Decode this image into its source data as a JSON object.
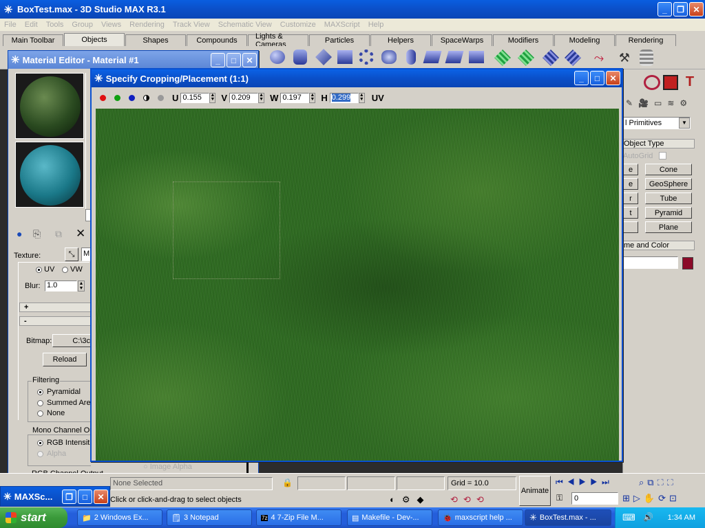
{
  "app": {
    "title": "BoxTest.max - 3D Studio MAX R3.1",
    "menu": [
      "File",
      "Edit",
      "Tools",
      "Group",
      "Views",
      "Rendering",
      "Track View",
      "Schematic View",
      "Customize",
      "MAXScript",
      "Help"
    ],
    "tabs": [
      "Main Toolbar",
      "Objects",
      "Shapes",
      "Compounds",
      "Lights & Cameras",
      "Particles",
      "Helpers",
      "SpaceWarps",
      "Modifiers",
      "Modeling",
      "Rendering"
    ],
    "active_tab": "Objects"
  },
  "material_editor": {
    "title": "Material Editor - Material #1",
    "texture_label": "Texture:",
    "uv_label": "UV",
    "vw_label": "VW",
    "blur_label": "Blur:",
    "blur_value": "1.0",
    "plus": "+",
    "minus": "-",
    "bitmap_label": "Bitmap:",
    "bitmap_path": "C:\\3c",
    "reload": "Reload",
    "filtering_label": "Filtering",
    "filter_options": [
      "Pyramidal",
      "Summed Are",
      "None"
    ],
    "mono_label": "Mono Channel Ou",
    "mono_options": [
      "RGB Intensit",
      "Alpha"
    ],
    "rgb_channel": "RGB Channel Output",
    "image_alpha": "Image Alpha"
  },
  "crop_dialog": {
    "title": "Specify Cropping/Placement (1:1)",
    "u_label": "U",
    "u_value": "0.155",
    "v_label": "V",
    "v_value": "0.209",
    "w_label": "W",
    "w_value": "0.197",
    "h_label": "H",
    "h_value": "0.299",
    "mode_label": "UV"
  },
  "command_panel": {
    "dropdown": "l Primitives",
    "rollout_object_type": "Object Type",
    "autogrid": "AutoGrid",
    "buttons": [
      "Cone",
      "GeoSphere",
      "Tube",
      "Pyramid",
      "Plane"
    ],
    "partial_buttons": [
      "e",
      "r",
      "t"
    ],
    "rollout_name_color": "me and Color",
    "object_color": "#8b0a28"
  },
  "status": {
    "none_selected": "None Selected",
    "prompt": "Click or click-and-drag to select objects",
    "grid": "Grid = 10.0",
    "animate": "Animate",
    "frame": "0"
  },
  "minimized_window": {
    "title": "MAXSc..."
  },
  "taskbar": {
    "start": "start",
    "tasks": [
      "2 Windows Ex...",
      "3 Notepad",
      "4 7-Zip File M...",
      "Makefile - Dev-...",
      "maxscript help ...",
      "BoxTest.max - ..."
    ],
    "time": "1:34 AM"
  }
}
